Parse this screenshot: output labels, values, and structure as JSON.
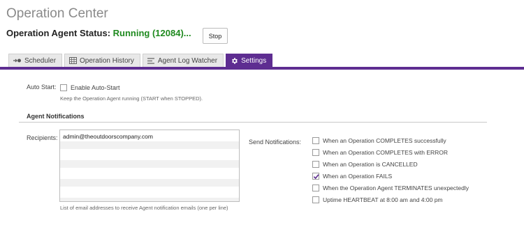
{
  "header": {
    "title": "Operation Center",
    "status_label": "Operation Agent Status:",
    "status_value": "Running (12084)...",
    "status_color": "#1f8a1f",
    "stop_label": "Stop"
  },
  "tabs": [
    {
      "label": "Scheduler",
      "icon": "arrow-dot-icon",
      "active": false
    },
    {
      "label": "Operation History",
      "icon": "table-icon",
      "active": false
    },
    {
      "label": "Agent Log Watcher",
      "icon": "lines-icon",
      "active": false
    },
    {
      "label": "Settings",
      "icon": "gear-icon",
      "active": true
    }
  ],
  "accent_color": "#5e2d91",
  "auto_start": {
    "label": "Auto Start:",
    "checkbox_label": "Enable Auto-Start",
    "checked": false,
    "hint": "Keep the Operation Agent running (START when STOPPED)."
  },
  "notifications": {
    "section_title": "Agent Notifications",
    "recipients_label": "Recipients:",
    "recipients_value": "admin@theoutdoorscompany.com",
    "recipients_hint": "List of email addresses to receive Agent notification emails (one per line)",
    "send_label": "Send Notifications:",
    "options": [
      {
        "label": "When an Operation COMPLETES successfully",
        "checked": false
      },
      {
        "label": "When an Operation COMPLETES with ERROR",
        "checked": false
      },
      {
        "label": "When an Operation is CANCELLED",
        "checked": false
      },
      {
        "label": "When an Operation FAILS",
        "checked": true
      },
      {
        "label": "When the Operation Agent TERMINATES unexpectedly",
        "checked": false
      },
      {
        "label": "Uptime HEARTBEAT at 8:00 am and 4:00 pm",
        "checked": false
      }
    ]
  }
}
